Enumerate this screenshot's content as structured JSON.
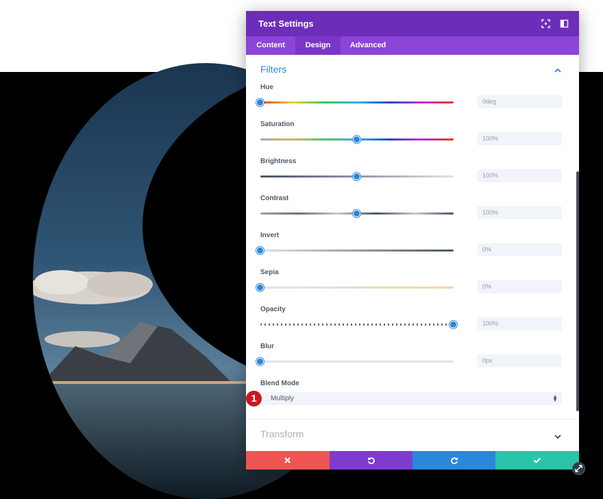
{
  "colors": {
    "header": "#6c2eb9",
    "tabs": "#8c44d9",
    "accent": "#2b87da",
    "cancel": "#ef5552",
    "undo": "#7e3bd0",
    "redo": "#2b87da",
    "save": "#29c4a9"
  },
  "modal": {
    "title": "Text Settings",
    "header_icons": [
      "expand-icon",
      "split-view-icon"
    ],
    "tabs": [
      {
        "label": "Content",
        "active": false
      },
      {
        "label": "Design",
        "active": true
      },
      {
        "label": "Advanced",
        "active": false
      }
    ]
  },
  "filters": {
    "title": "Filters",
    "expanded": true,
    "fields": [
      {
        "label": "Hue",
        "value": "0deg",
        "level": 0.0
      },
      {
        "label": "Saturation",
        "value": "100%",
        "level": 0.5
      },
      {
        "label": "Brightness",
        "value": "100%",
        "level": 0.5
      },
      {
        "label": "Contrast",
        "value": "100%",
        "level": 0.5
      },
      {
        "label": "Invert",
        "value": "0%",
        "level": 0.0
      },
      {
        "label": "Sepia",
        "value": "0%",
        "level": 0.0
      },
      {
        "label": "Opacity",
        "value": "100%",
        "level": 1.0
      },
      {
        "label": "Blur",
        "value": "0px",
        "level": 0.0
      }
    ],
    "blend_mode": {
      "label": "Blend Mode",
      "value": "Multiply"
    },
    "badge": "1"
  },
  "transform": {
    "title": "Transform",
    "expanded": false
  },
  "footer": {
    "buttons": [
      "cancel-icon",
      "undo-icon",
      "redo-icon",
      "save-check-icon"
    ]
  }
}
